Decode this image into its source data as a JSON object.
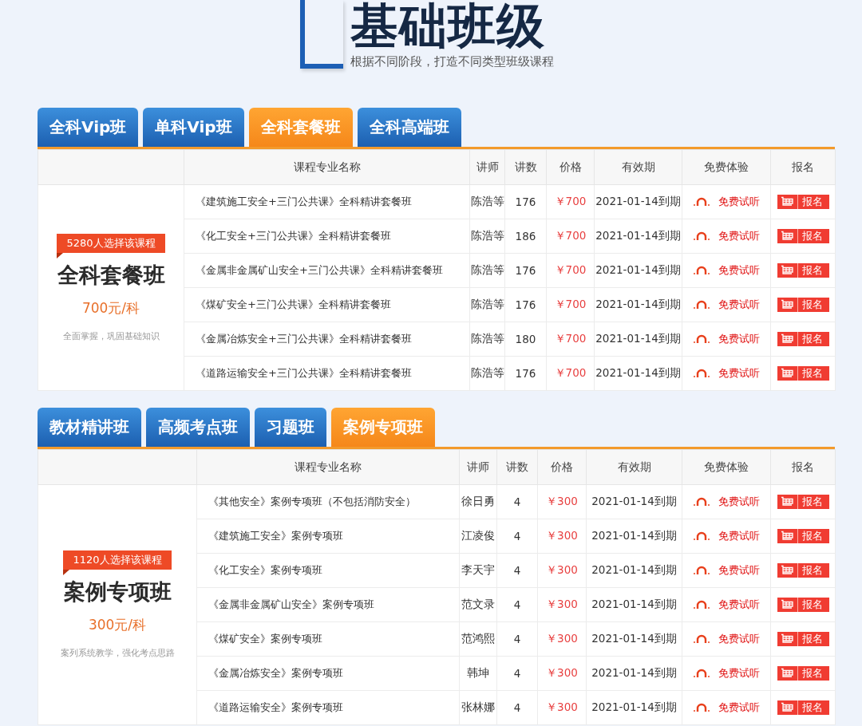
{
  "header": {
    "title": "基础班级",
    "subtitle": "根据不同阶段，打造不同类型班级课程"
  },
  "sections": [
    {
      "tabs": [
        {
          "label": "全科Vip班",
          "selected": false
        },
        {
          "label": "单科Vip班",
          "selected": false
        },
        {
          "label": "全科套餐班",
          "selected": true
        },
        {
          "label": "全科高端班",
          "selected": false
        }
      ],
      "columns": [
        "课程专业名称",
        "讲师",
        "讲数",
        "价格",
        "有效期",
        "免费体验",
        "报名"
      ],
      "summary": {
        "badge": "5280人选择该课程",
        "title": "全科套餐班",
        "price": "700元/科",
        "description": "全面掌握，巩固基础知识"
      },
      "rows": [
        {
          "name": "《建筑施工安全+三门公共课》全科精讲套餐班",
          "lecturer": "陈浩等",
          "lectures": "176",
          "price": "￥700",
          "validity": "2021-01-14到期",
          "trial": "免费试听",
          "signup": "报名"
        },
        {
          "name": "《化工安全+三门公共课》全科精讲套餐班",
          "lecturer": "陈浩等",
          "lectures": "186",
          "price": "￥700",
          "validity": "2021-01-14到期",
          "trial": "免费试听",
          "signup": "报名"
        },
        {
          "name": "《金属非金属矿山安全+三门公共课》全科精讲套餐班",
          "lecturer": "陈浩等",
          "lectures": "176",
          "price": "￥700",
          "validity": "2021-01-14到期",
          "trial": "免费试听",
          "signup": "报名"
        },
        {
          "name": "《煤矿安全+三门公共课》全科精讲套餐班",
          "lecturer": "陈浩等",
          "lectures": "176",
          "price": "￥700",
          "validity": "2021-01-14到期",
          "trial": "免费试听",
          "signup": "报名"
        },
        {
          "name": "《金属冶炼安全+三门公共课》全科精讲套餐班",
          "lecturer": "陈浩等",
          "lectures": "180",
          "price": "￥700",
          "validity": "2021-01-14到期",
          "trial": "免费试听",
          "signup": "报名"
        },
        {
          "name": "《道路运输安全+三门公共课》全科精讲套餐班",
          "lecturer": "陈浩等",
          "lectures": "176",
          "price": "￥700",
          "validity": "2021-01-14到期",
          "trial": "免费试听",
          "signup": "报名"
        }
      ]
    },
    {
      "tabs": [
        {
          "label": "教材精讲班",
          "selected": false
        },
        {
          "label": "高频考点班",
          "selected": false
        },
        {
          "label": "习题班",
          "selected": false
        },
        {
          "label": "案例专项班",
          "selected": true
        }
      ],
      "columns": [
        "课程专业名称",
        "讲师",
        "讲数",
        "价格",
        "有效期",
        "免费体验",
        "报名"
      ],
      "summary": {
        "badge": "1120人选择该课程",
        "title": "案例专项班",
        "price": "300元/科",
        "description": "案列系统教学，强化考点思路"
      },
      "rows": [
        {
          "name": "《其他安全》案例专项班（不包括消防安全）",
          "lecturer": "徐日勇",
          "lectures": "4",
          "price": "￥300",
          "validity": "2021-01-14到期",
          "trial": "免费试听",
          "signup": "报名"
        },
        {
          "name": "《建筑施工安全》案例专项班",
          "lecturer": "江凌俊",
          "lectures": "4",
          "price": "￥300",
          "validity": "2021-01-14到期",
          "trial": "免费试听",
          "signup": "报名"
        },
        {
          "name": "《化工安全》案例专项班",
          "lecturer": "李天宇",
          "lectures": "4",
          "price": "￥300",
          "validity": "2021-01-14到期",
          "trial": "免费试听",
          "signup": "报名"
        },
        {
          "name": "《金属非金属矿山安全》案例专项班",
          "lecturer": "范文录",
          "lectures": "4",
          "price": "￥300",
          "validity": "2021-01-14到期",
          "trial": "免费试听",
          "signup": "报名"
        },
        {
          "name": "《煤矿安全》案例专项班",
          "lecturer": "范鸿熙",
          "lectures": "4",
          "price": "￥300",
          "validity": "2021-01-14到期",
          "trial": "免费试听",
          "signup": "报名"
        },
        {
          "name": "《金属冶炼安全》案例专项班",
          "lecturer": "韩坤",
          "lectures": "4",
          "price": "￥300",
          "validity": "2021-01-14到期",
          "trial": "免费试听",
          "signup": "报名"
        },
        {
          "name": "《道路运输安全》案例专项班",
          "lecturer": "张林娜",
          "lectures": "4",
          "price": "￥300",
          "validity": "2021-01-14到期",
          "trial": "免费试听",
          "signup": "报名"
        }
      ]
    }
  ]
}
